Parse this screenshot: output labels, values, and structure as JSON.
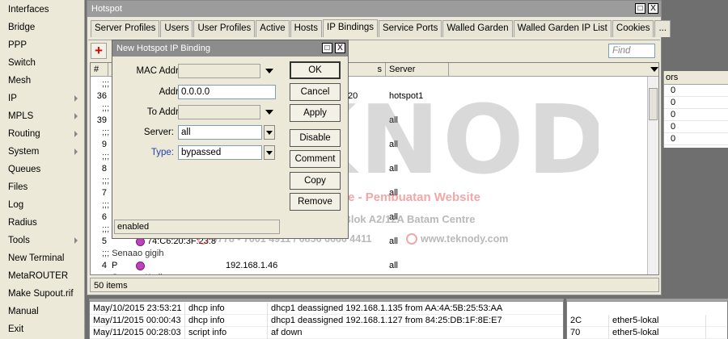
{
  "sidebar": {
    "items": [
      {
        "label": "Interfaces",
        "submenu": false
      },
      {
        "label": "Bridge",
        "submenu": false
      },
      {
        "label": "PPP",
        "submenu": false
      },
      {
        "label": "Switch",
        "submenu": false
      },
      {
        "label": "Mesh",
        "submenu": false
      },
      {
        "label": "IP",
        "submenu": true
      },
      {
        "label": "MPLS",
        "submenu": true
      },
      {
        "label": "Routing",
        "submenu": true
      },
      {
        "label": "System",
        "submenu": true
      },
      {
        "label": "Queues",
        "submenu": false
      },
      {
        "label": "Files",
        "submenu": false
      },
      {
        "label": "Log",
        "submenu": false
      },
      {
        "label": "Radius",
        "submenu": false
      },
      {
        "label": "Tools",
        "submenu": true
      },
      {
        "label": "New Terminal",
        "submenu": false
      },
      {
        "label": "MetaROUTER",
        "submenu": false
      },
      {
        "label": "Make Supout.rif",
        "submenu": false
      },
      {
        "label": "Manual",
        "submenu": false
      },
      {
        "label": "Exit",
        "submenu": false
      }
    ]
  },
  "hotspot": {
    "title": "Hotspot",
    "restore_glyph": "□",
    "close_glyph": "X",
    "tabs": [
      {
        "label": "Server Profiles",
        "active": false
      },
      {
        "label": "Users",
        "active": false
      },
      {
        "label": "User Profiles",
        "active": false
      },
      {
        "label": "Active",
        "active": false
      },
      {
        "label": "Hosts",
        "active": false
      },
      {
        "label": "IP Bindings",
        "active": true
      },
      {
        "label": "Service Ports",
        "active": false
      },
      {
        "label": "Walled Garden",
        "active": false
      },
      {
        "label": "Walled Garden IP List",
        "active": false
      },
      {
        "label": "Cookies",
        "active": false
      },
      {
        "label": "...",
        "active": false
      }
    ],
    "add_glyph": "+",
    "find_placeholder": "Find",
    "columns": [
      "#",
      "s",
      "Server"
    ],
    "rows": [
      {
        "kind": "comment",
        "text": ";;;"
      },
      {
        "kind": "data",
        "num": "36",
        "flag": "",
        "mac": "",
        "address": "",
        "to": "20",
        "server": "hotspot1"
      },
      {
        "kind": "comment",
        "text": ";;;"
      },
      {
        "kind": "data",
        "num": "39",
        "flag": "",
        "mac": "",
        "address": "",
        "to": "",
        "server": "all"
      },
      {
        "kind": "comment",
        "text": ";;;"
      },
      {
        "kind": "data",
        "num": "9",
        "flag": "",
        "mac": "",
        "address": "",
        "to": "",
        "server": "all"
      },
      {
        "kind": "comment",
        "text": ";;;"
      },
      {
        "kind": "data",
        "num": "8",
        "flag": "",
        "mac": "",
        "address": "",
        "to": "",
        "server": "all"
      },
      {
        "kind": "comment",
        "text": ";;;"
      },
      {
        "kind": "data",
        "num": "7",
        "flag": "",
        "mac": "",
        "address": "",
        "to": "",
        "server": "all"
      },
      {
        "kind": "comment",
        "text": ";;;"
      },
      {
        "kind": "data",
        "num": "6",
        "flag": "",
        "mac": "",
        "address": "",
        "to": "",
        "server": "all"
      },
      {
        "kind": "comment",
        "text": ";;;"
      },
      {
        "kind": "data",
        "num": "5",
        "flag": "",
        "mac": "74:C6:20:3F:23:8",
        "address": "",
        "to": "",
        "server": "all"
      },
      {
        "kind": "comment",
        "text": ";;; Senaao gigih"
      },
      {
        "kind": "data",
        "num": "4",
        "flag": "P",
        "mac": "",
        "address": "192.168.1.46",
        "to": "",
        "server": "all"
      },
      {
        "kind": "comment",
        "text": ";;; Senaao Kutilang"
      }
    ],
    "status": "50 items"
  },
  "right_list": {
    "header": "ors",
    "values": [
      "0",
      "0",
      "0",
      "0",
      "0"
    ]
  },
  "dialog": {
    "title": "New Hotspot IP Binding",
    "restore_glyph": "□",
    "close_glyph": "X",
    "fields": {
      "mac_label": "MAC Address:",
      "mac_value": "",
      "address_label": "Address:",
      "address_value": "0.0.0.0",
      "to_address_label": "To Address:",
      "to_address_value": "",
      "server_label": "Server:",
      "server_value": "all",
      "type_label": "Type:",
      "type_value": "bypassed"
    },
    "buttons": {
      "ok": "OK",
      "cancel": "Cancel",
      "apply": "Apply",
      "disable": "Disable",
      "comment": "Comment",
      "copy": "Copy",
      "remove": "Remove"
    },
    "status": "enabled"
  },
  "log": {
    "rows": [
      {
        "time": "May/10/2015 23:53:21",
        "topic": "dhcp info",
        "message": "dhcp1 deassigned 192.168.1.135 from AA:4A:5B:25:53:AA"
      },
      {
        "time": "May/11/2015 00:00:43",
        "topic": "dhcp info",
        "message": "dhcp1 deassigned 192.168.1.127 from 84:25:DB:1F:8E:E7"
      },
      {
        "time": "May/11/2015 00:28:03",
        "topic": "script info",
        "message": "af down"
      }
    ]
  },
  "interfaces_mini": {
    "rows": [
      {
        "mac": "2C",
        "iface": "ether5-lokal"
      },
      {
        "mac": "70",
        "iface": "ether5-lokal"
      }
    ]
  },
  "watermark": {
    "logo": "TEKNODY",
    "line1": "Sales & Service - IT Maintenance - Pembuatan Website",
    "line2": "Townhouse Glory Home's Blok A2/12A Batam Centre",
    "line3": "0778 - 7001 4911 / 0856 6666 4411",
    "website": "www.teknody.com",
    "colors": {
      "red": "#dc3c3c",
      "gray": "#787878"
    }
  }
}
